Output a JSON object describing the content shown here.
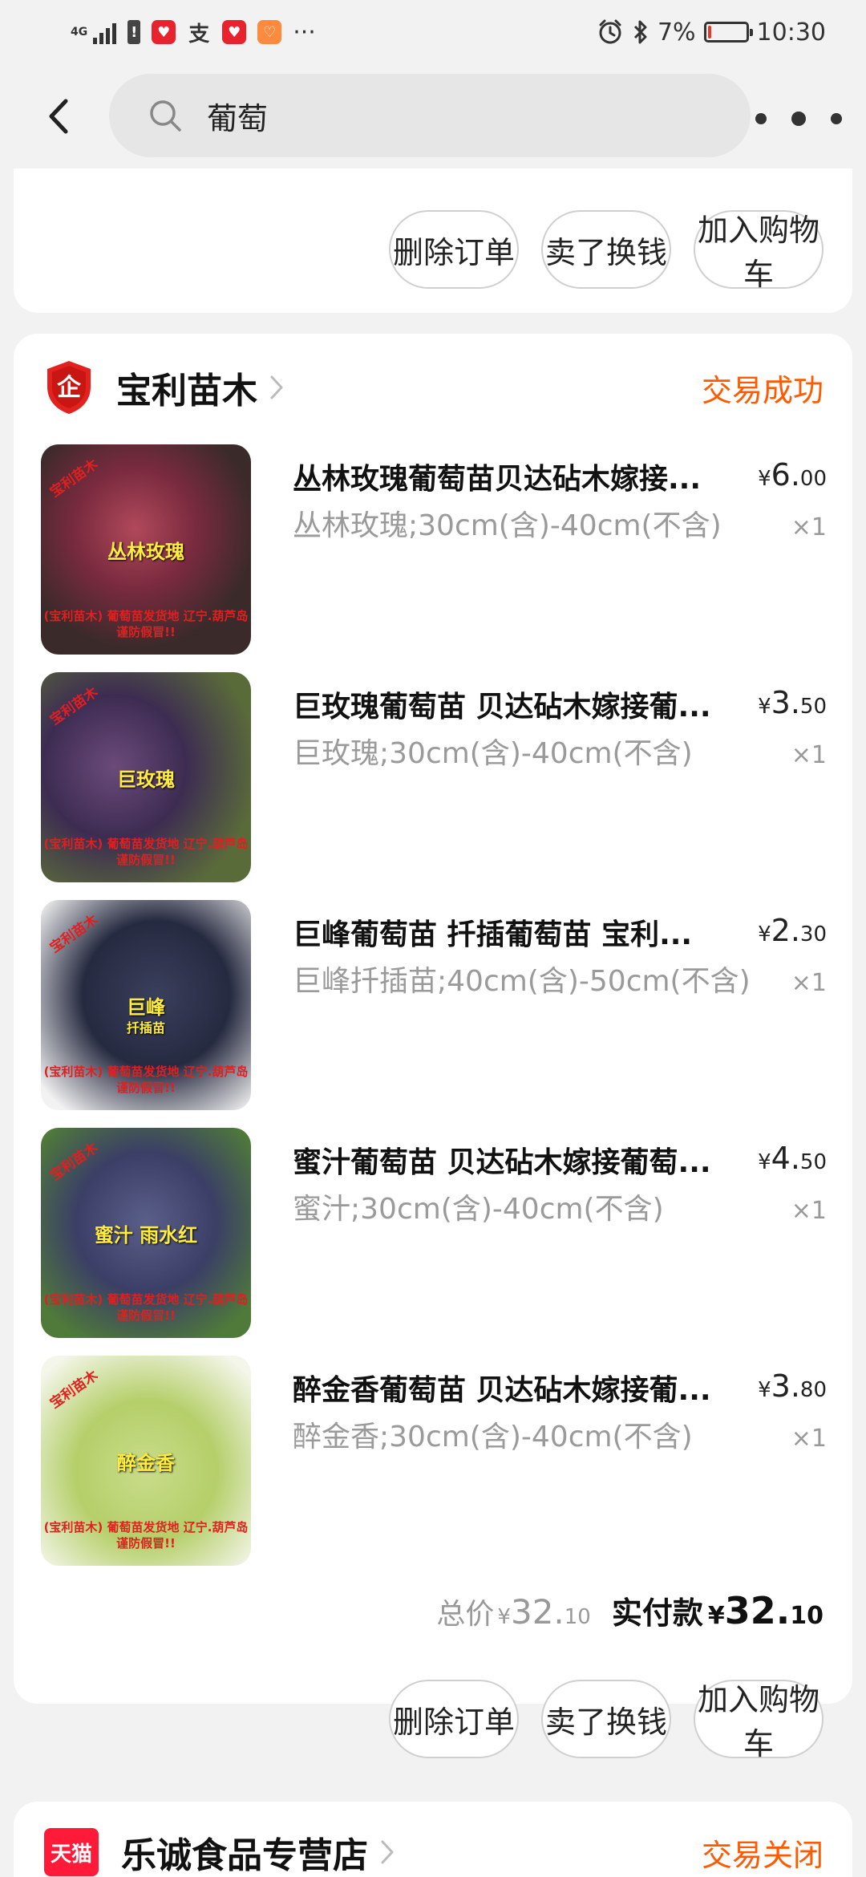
{
  "status_bar": {
    "network": "4G",
    "battery_pct": "7%",
    "battery_level": 0.07,
    "time": "10:30",
    "more": "···",
    "icons": [
      "signal-icon",
      "alert-icon",
      "app-badge-icon",
      "alipay-icon",
      "app-badge-icon",
      "app-badge-icon",
      "alarm-icon",
      "bluetooth-icon",
      "battery-icon"
    ]
  },
  "header": {
    "search_text": "葡萄",
    "icons": [
      "back-arrow-icon",
      "search-icon",
      "more-dots-icon"
    ]
  },
  "order_actions": {
    "delete": "删除订单",
    "sell": "卖了换钱",
    "add_cart": "加入购物车"
  },
  "shop": {
    "name": "宝利苗木",
    "status": "交易成功",
    "status_color": "#ff5a00",
    "badge_text": "企"
  },
  "items": [
    {
      "title": "丛林玫瑰葡萄苗贝达砧木嫁接...",
      "spec": "丛林玫瑰;30cm(含)-40cm(不含)",
      "price_cur": "¥",
      "price_int": "6.",
      "price_dec": "00",
      "qty": "×1",
      "img_label": "丛林玫瑰",
      "img_corner": "宝利苗木",
      "img_foot": "(宝利苗木) 葡萄苗发货地 辽宁.葫芦岛 谨防假冒!!"
    },
    {
      "title": "巨玫瑰葡萄苗 贝达砧木嫁接葡...",
      "spec": "巨玫瑰;30cm(含)-40cm(不含)",
      "price_cur": "¥",
      "price_int": "3.",
      "price_dec": "50",
      "qty": "×1",
      "img_label": "巨玫瑰",
      "img_corner": "宝利苗木",
      "img_foot": "(宝利苗木) 葡萄苗发货地 辽宁.葫芦岛 谨防假冒!!"
    },
    {
      "title": "巨峰葡萄苗 扦插葡萄苗 宝利...",
      "spec": "巨峰扦插苗;40cm(含)-50cm(不含)",
      "price_cur": "¥",
      "price_int": "2.",
      "price_dec": "30",
      "qty": "×1",
      "img_label": "巨峰",
      "img_sub": "扦插苗",
      "img_corner": "宝利苗木",
      "img_foot": "(宝利苗木) 葡萄苗发货地 辽宁.葫芦岛 谨防假冒!!"
    },
    {
      "title": "蜜汁葡萄苗 贝达砧木嫁接葡萄...",
      "spec": "蜜汁;30cm(含)-40cm(不含)",
      "price_cur": "¥",
      "price_int": "4.",
      "price_dec": "50",
      "qty": "×1",
      "img_label": "蜜汁 雨水红",
      "img_corner": "宝利苗木",
      "img_foot": "(宝利苗木) 葡萄苗发货地 辽宁.葫芦岛 谨防假冒!!"
    },
    {
      "title": "醉金香葡萄苗 贝达砧木嫁接葡...",
      "spec": "醉金香;30cm(含)-40cm(不含)",
      "price_cur": "¥",
      "price_int": "3.",
      "price_dec": "80",
      "qty": "×1",
      "img_label": "醉金香",
      "img_corner": "宝利苗木",
      "img_foot": "(宝利苗木) 葡萄苗发货地 辽宁.葫芦岛 谨防假冒!!"
    }
  ],
  "totals": {
    "total_label": "总价",
    "total_cur": "¥",
    "total_int": "32.",
    "total_dec": "10",
    "paid_label": "实付款",
    "paid_cur": "¥",
    "paid_int": "32.",
    "paid_dec": "10"
  },
  "next_shop": {
    "badge": "天猫",
    "name": "乐诚食品专营店",
    "status": "交易关闭",
    "status_color": "#ff5a00"
  }
}
